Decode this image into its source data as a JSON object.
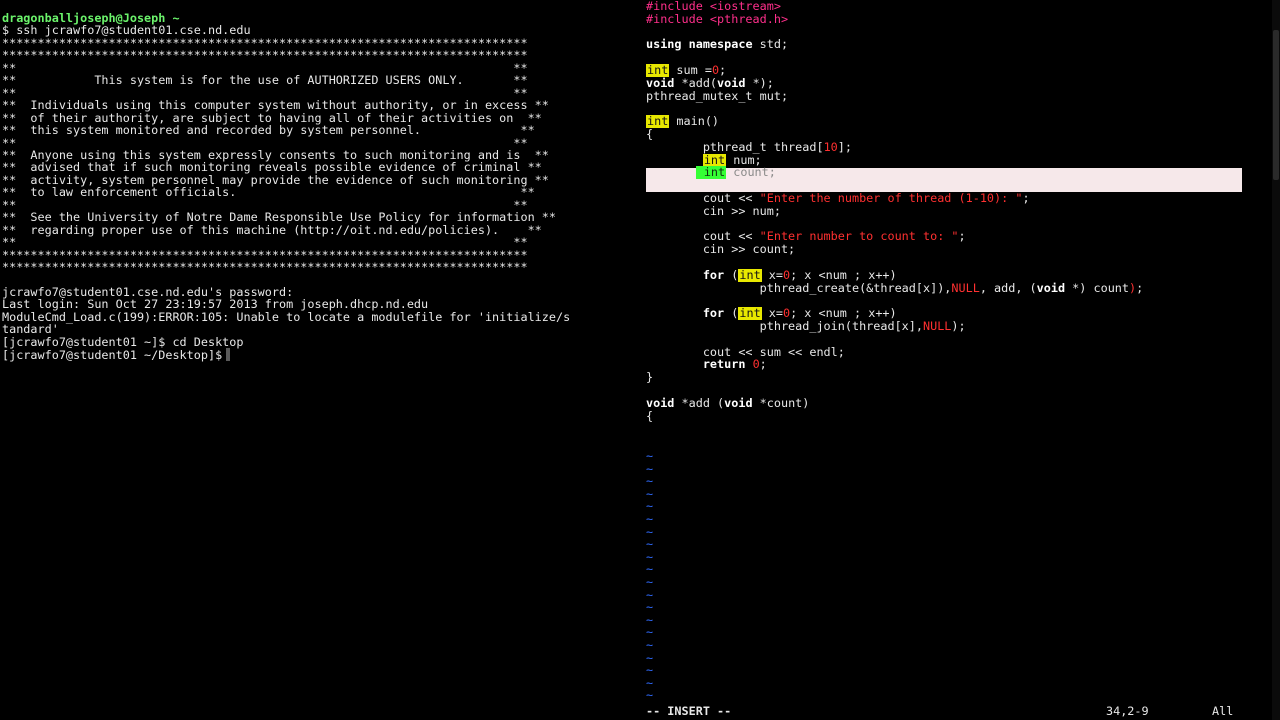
{
  "terminal": {
    "lines": [
      {
        "text": "dragonballjoseph@Joseph ~",
        "kind": "prompt-user"
      },
      {
        "text": "$ ssh jcrawfo7@student01.cse.nd.edu",
        "kind": "normal"
      },
      {
        "text": "**************************************************************************",
        "kind": "normal"
      },
      {
        "text": "**************************************************************************",
        "kind": "normal"
      },
      {
        "text": "**                                                                      **",
        "kind": "normal"
      },
      {
        "text": "**           This system is for the use of AUTHORIZED USERS ONLY.       **",
        "kind": "normal"
      },
      {
        "text": "**                                                                      **",
        "kind": "normal"
      },
      {
        "text": "**  Individuals using this computer system without authority, or in excess **",
        "kind": "normal"
      },
      {
        "text": "**  of their authority, are subject to having all of their activities on  **",
        "kind": "normal"
      },
      {
        "text": "**  this system monitored and recorded by system personnel.              **",
        "kind": "normal"
      },
      {
        "text": "**                                                                      **",
        "kind": "normal"
      },
      {
        "text": "**  Anyone using this system expressly consents to such monitoring and is  **",
        "kind": "normal"
      },
      {
        "text": "**  advised that if such monitoring reveals possible evidence of criminal **",
        "kind": "normal"
      },
      {
        "text": "**  activity, system personnel may provide the evidence of such monitoring **",
        "kind": "normal"
      },
      {
        "text": "**  to law enforcement officials.                                        **",
        "kind": "normal"
      },
      {
        "text": "**                                                                      **",
        "kind": "normal"
      },
      {
        "text": "**  See the University of Notre Dame Responsible Use Policy for information **",
        "kind": "normal"
      },
      {
        "text": "**  regarding proper use of this machine (http://oit.nd.edu/policies).    **",
        "kind": "normal"
      },
      {
        "text": "**                                                                      **",
        "kind": "normal"
      },
      {
        "text": "**************************************************************************",
        "kind": "normal"
      },
      {
        "text": "**************************************************************************",
        "kind": "normal"
      },
      {
        "text": "",
        "kind": "normal"
      },
      {
        "text": "jcrawfo7@student01.cse.nd.edu's password:",
        "kind": "normal"
      },
      {
        "text": "Last login: Sun Oct 27 23:19:57 2013 from joseph.dhcp.nd.edu",
        "kind": "normal"
      },
      {
        "text": "ModuleCmd_Load.c(199):ERROR:105: Unable to locate a modulefile for 'initialize/s",
        "kind": "normal"
      },
      {
        "text": "tandard'",
        "kind": "normal"
      },
      {
        "text": "[jcrawfo7@student01 ~]$ cd Desktop",
        "kind": "normal"
      },
      {
        "text": "[jcrawfo7@student01 ~/Desktop]$",
        "kind": "prompt-cursor"
      }
    ]
  },
  "vim": {
    "lines": [
      {
        "segments": [
          {
            "t": "#include <iostream>",
            "c": "pp"
          }
        ]
      },
      {
        "segments": [
          {
            "t": "#include <pthread.h>",
            "c": "pp"
          }
        ]
      },
      {
        "segments": []
      },
      {
        "segments": [
          {
            "t": "using ",
            "c": "keyword"
          },
          {
            "t": "namespace",
            "c": "keyword"
          },
          {
            "t": " std;",
            "c": ""
          }
        ]
      },
      {
        "segments": []
      },
      {
        "segments": [
          {
            "t": "int",
            "c": "type-hi"
          },
          {
            "t": " sum =",
            "c": ""
          },
          {
            "t": "0",
            "c": "number"
          },
          {
            "t": ";",
            "c": ""
          }
        ]
      },
      {
        "segments": [
          {
            "t": "void",
            "c": "keyword"
          },
          {
            "t": " *add(",
            "c": ""
          },
          {
            "t": "void",
            "c": "keyword"
          },
          {
            "t": " *);",
            "c": ""
          }
        ]
      },
      {
        "segments": [
          {
            "t": "pthread_mutex_t mut;",
            "c": ""
          }
        ]
      },
      {
        "segments": []
      },
      {
        "segments": [
          {
            "t": "int",
            "c": "type-hi"
          },
          {
            "t": " main()",
            "c": ""
          }
        ]
      },
      {
        "segments": [
          {
            "t": "{",
            "c": ""
          }
        ]
      },
      {
        "segments": [
          {
            "t": "        pthread_t thread[",
            "c": ""
          },
          {
            "t": "10",
            "c": "number"
          },
          {
            "t": "];",
            "c": ""
          }
        ]
      },
      {
        "segments": [
          {
            "t": "        ",
            "c": ""
          },
          {
            "t": "int",
            "c": "type-hi"
          },
          {
            "t": " num;",
            "c": ""
          }
        ]
      },
      {
        "segments": [
          {
            "t": "       ",
            "c": ""
          },
          {
            "t": " int",
            "c": "type-hi-green"
          },
          {
            "t": " count;",
            "c": "vim-cursorline-text"
          }
        ]
      },
      {
        "segments": []
      },
      {
        "segments": [
          {
            "t": "        cout << ",
            "c": ""
          },
          {
            "t": "\"Enter the number of thread (1-10): \"",
            "c": "string"
          },
          {
            "t": ";",
            "c": ""
          }
        ]
      },
      {
        "segments": [
          {
            "t": "        cin >> num;",
            "c": ""
          }
        ]
      },
      {
        "segments": []
      },
      {
        "segments": [
          {
            "t": "        cout << ",
            "c": ""
          },
          {
            "t": "\"Enter number to count to: \"",
            "c": "string"
          },
          {
            "t": ";",
            "c": ""
          }
        ]
      },
      {
        "segments": [
          {
            "t": "        cin >> count;",
            "c": ""
          }
        ]
      },
      {
        "segments": []
      },
      {
        "segments": [
          {
            "t": "        ",
            "c": ""
          },
          {
            "t": "for",
            "c": "keyword"
          },
          {
            "t": " (",
            "c": ""
          },
          {
            "t": "int",
            "c": "type-hi"
          },
          {
            "t": " x=",
            "c": ""
          },
          {
            "t": "0",
            "c": "number"
          },
          {
            "t": "; x <num ; x++)",
            "c": ""
          }
        ]
      },
      {
        "segments": [
          {
            "t": "                pthread_create(&thread[x]),",
            "c": ""
          },
          {
            "t": "NULL",
            "c": "number"
          },
          {
            "t": ", add, (",
            "c": ""
          },
          {
            "t": "void",
            "c": "keyword"
          },
          {
            "t": " *) count",
            "c": ""
          },
          {
            "t": ")",
            "c": "number"
          },
          {
            "t": ";",
            "c": ""
          }
        ]
      },
      {
        "segments": []
      },
      {
        "segments": [
          {
            "t": "        ",
            "c": ""
          },
          {
            "t": "for",
            "c": "keyword"
          },
          {
            "t": " (",
            "c": ""
          },
          {
            "t": "int",
            "c": "type-hi"
          },
          {
            "t": " x=",
            "c": ""
          },
          {
            "t": "0",
            "c": "number"
          },
          {
            "t": "; x <num ; x++)",
            "c": ""
          }
        ]
      },
      {
        "segments": [
          {
            "t": "                pthread_join(thread[x],",
            "c": ""
          },
          {
            "t": "NULL",
            "c": "number"
          },
          {
            "t": ");",
            "c": ""
          }
        ]
      },
      {
        "segments": []
      },
      {
        "segments": [
          {
            "t": "        cout << sum << endl;",
            "c": ""
          }
        ]
      },
      {
        "segments": [
          {
            "t": "        ",
            "c": ""
          },
          {
            "t": "return",
            "c": "keyword"
          },
          {
            "t": " ",
            "c": ""
          },
          {
            "t": "0",
            "c": "number"
          },
          {
            "t": ";",
            "c": ""
          }
        ]
      },
      {
        "segments": [
          {
            "t": "}",
            "c": ""
          }
        ]
      },
      {
        "segments": []
      },
      {
        "segments": [
          {
            "t": "void",
            "c": "keyword"
          },
          {
            "t": " *add (",
            "c": ""
          },
          {
            "t": "void",
            "c": "keyword"
          },
          {
            "t": " *count)",
            "c": ""
          }
        ]
      },
      {
        "segments": [
          {
            "t": "{",
            "c": ""
          }
        ]
      }
    ],
    "tilde_count": 20,
    "status": {
      "mode": "-- INSERT --",
      "position": "34,2-9",
      "scroll": "All"
    }
  },
  "colors": {
    "terminal_bg": "#000000",
    "text": "#e8e8e8",
    "prompt_user": "#6bf36b",
    "preprocessor": "#ff2f8b",
    "string": "#ff3030",
    "type_highlight": "#e8e800",
    "cursorline": "#f6e8ea",
    "tilde": "#2f6bff"
  }
}
